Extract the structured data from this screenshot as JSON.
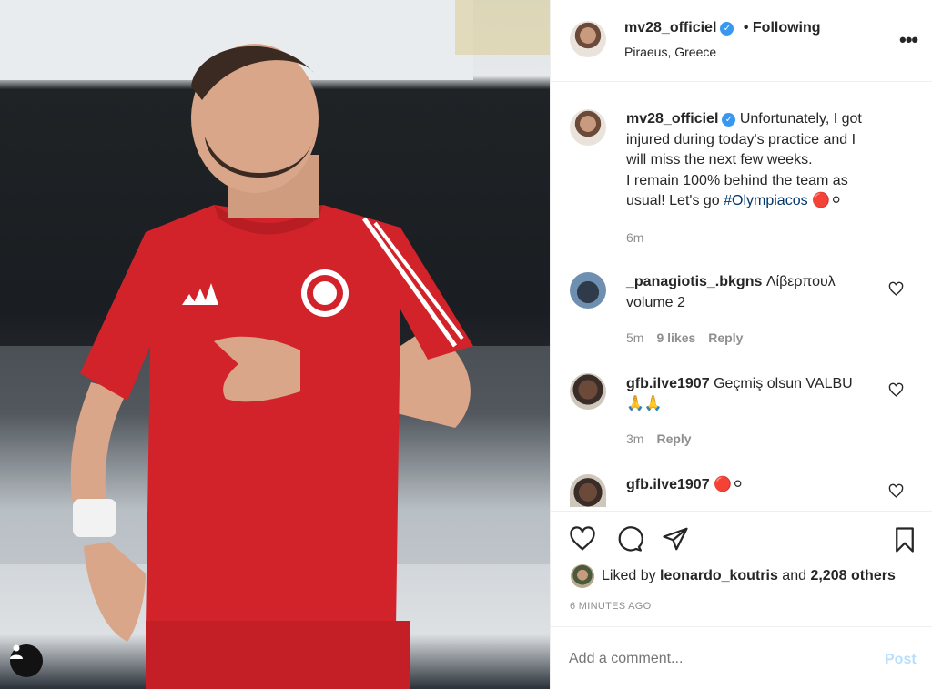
{
  "post": {
    "username": "mv28_officiel",
    "follow_status": "• Following",
    "location": "Piraeus, Greece",
    "more_icon": "more-dots-icon",
    "verified_mark": "✓"
  },
  "caption": {
    "username": "mv28_officiel",
    "line1": "Unfortunately, I got",
    "line2": "injured during today's practice and I",
    "line3": "will miss the next few weeks.",
    "line4": "I remain 100% behind the team as",
    "line5_prefix": "usual! Let's go ",
    "hashtag": "#Olympiacos",
    "emoji": "🔴⚪",
    "time": "6m"
  },
  "comments": [
    {
      "username": "_panagiotis_.bkgns",
      "text": "Λίβερπουλ",
      "text2": "volume 2",
      "time": "5m",
      "likes": "9 likes",
      "reply": "Reply"
    },
    {
      "username": "gfb.ilve1907",
      "text": "Geçmiş olsun VALBU",
      "text2": "🙏🙏",
      "time": "3m",
      "reply": "Reply"
    },
    {
      "username": "gfb.ilve1907",
      "text": "🔴⚪"
    }
  ],
  "likes": {
    "prefix": "Liked by ",
    "user": "leonardo_koutris",
    "middle": " and ",
    "count": "2,208 others"
  },
  "timestamp": "6 MINUTES AGO",
  "add_comment": {
    "placeholder": "Add a comment...",
    "post_label": "Post"
  },
  "colors": {
    "accent": "#3897f0",
    "hashtag": "#00376b",
    "jersey": "#d2232a",
    "muted": "#8e8e8e"
  }
}
